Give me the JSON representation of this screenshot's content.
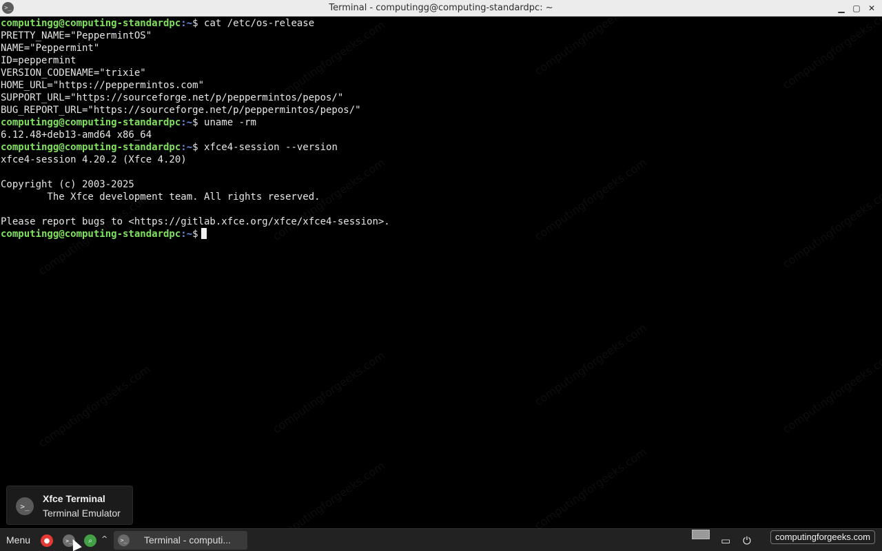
{
  "window": {
    "title": "Terminal - computingg@computing-standardpc: ~",
    "icon": "terminal-icon",
    "controls": [
      "minimize-icon",
      "maximize-icon",
      "close-icon"
    ],
    "minimize_glyph": "▁",
    "maximize_glyph": "▢",
    "close_glyph": "✕"
  },
  "terminal": {
    "prompt_user": "computingg@computing-standardpc",
    "prompt_path": ":~",
    "prompt_symbol": "$",
    "lines": [
      {
        "type": "prompt",
        "command": "cat /etc/os-release"
      },
      {
        "type": "output",
        "text": "PRETTY_NAME=\"PeppermintOS\""
      },
      {
        "type": "output",
        "text": "NAME=\"Peppermint\""
      },
      {
        "type": "output",
        "text": "ID=peppermint"
      },
      {
        "type": "output",
        "text": "VERSION_CODENAME=\"trixie\""
      },
      {
        "type": "output",
        "text": "HOME_URL=\"https://peppermintos.com\""
      },
      {
        "type": "output",
        "text": "SUPPORT_URL=\"https://sourceforge.net/p/peppermintos/pepos/\""
      },
      {
        "type": "output",
        "text": "BUG_REPORT_URL=\"https://sourceforge.net/p/peppermintos/pepos/\""
      },
      {
        "type": "prompt",
        "command": "uname -rm"
      },
      {
        "type": "output",
        "text": "6.12.48+deb13-amd64 x86_64"
      },
      {
        "type": "prompt",
        "command": "xfce4-session --version"
      },
      {
        "type": "output",
        "text": "xfce4-session 4.20.2 (Xfce 4.20)"
      },
      {
        "type": "output",
        "text": ""
      },
      {
        "type": "output",
        "text": "Copyright (c) 2003-2025"
      },
      {
        "type": "output",
        "text": "        The Xfce development team. All rights reserved."
      },
      {
        "type": "output",
        "text": ""
      },
      {
        "type": "output",
        "text": "Please report bugs to <https://gitlab.xfce.org/xfce/xfce4-session>."
      },
      {
        "type": "prompt",
        "command": "",
        "cursor": true
      }
    ]
  },
  "watermark": "computingforgeeks.com",
  "notification": {
    "title": "Xfce Terminal",
    "body": "Terminal Emulator",
    "icon": "terminal-icon",
    "icon_glyph": ">_"
  },
  "taskbar": {
    "menu_label": "Menu",
    "launchers": [
      {
        "name": "red-app-launcher-icon",
        "color": "#e53935",
        "glyph": "●"
      },
      {
        "name": "terminal-launcher-icon",
        "color": "#777777",
        "glyph": ">_"
      },
      {
        "name": "search-launcher-icon",
        "color": "#43a047",
        "glyph": "⌕"
      }
    ],
    "chevron_glyph": "^",
    "task": {
      "label": "Terminal - computi...",
      "icon": "terminal-icon",
      "icon_glyph": ">_"
    },
    "tray": [
      {
        "name": "display-icon",
        "glyph": "▭"
      },
      {
        "name": "power-plug-icon",
        "glyph": "⏻"
      }
    ],
    "tray_label": "computingforgeeks.com"
  }
}
